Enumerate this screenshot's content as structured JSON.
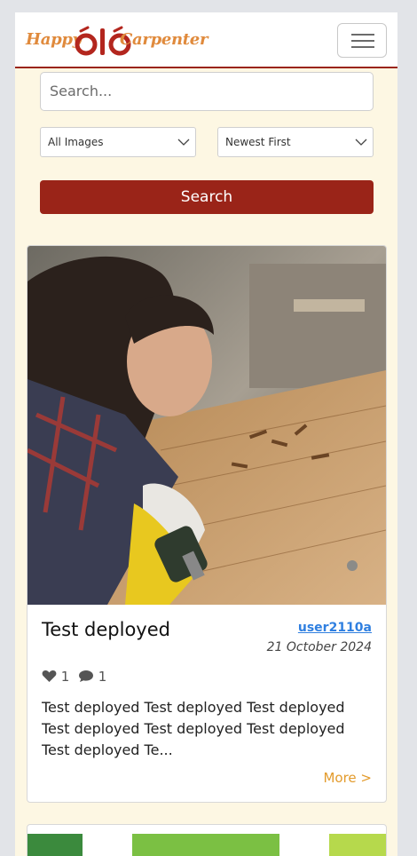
{
  "header": {
    "logo_left": "Happy",
    "logo_right": "Carpenter"
  },
  "search": {
    "placeholder": "Search...",
    "category_filter": "All Images",
    "sort_order": "Newest First",
    "button_label": "Search"
  },
  "post": {
    "title": "Test deployed",
    "author": "user2110a",
    "date": "21 October 2024",
    "likes": "1",
    "comments": "1",
    "excerpt": "Test deployed Test deployed Test deployed Test deployed Test deployed Test deployed Test deployed Te...",
    "more_label": "More >"
  },
  "colors": {
    "brand": "#9a2418",
    "accent": "#e39b2c",
    "link": "#2f7fe0",
    "background": "#fdf7e3"
  }
}
